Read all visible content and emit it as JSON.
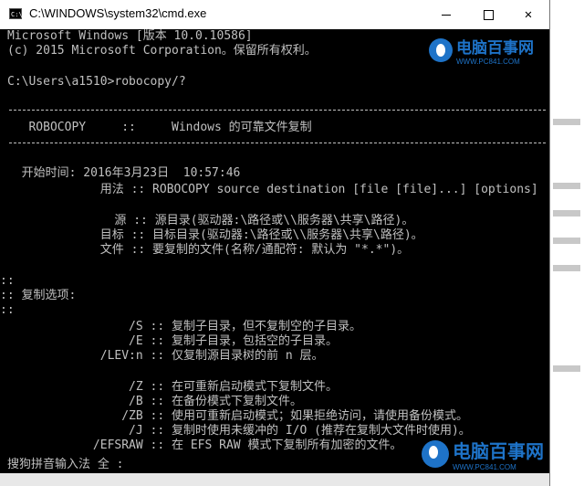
{
  "window": {
    "title": "C:\\WINDOWS\\system32\\cmd.exe",
    "icon_label": "C:\\",
    "close_glyph": "✕"
  },
  "console": {
    "lines": [
      "Microsoft Windows [版本 10.0.10586]",
      "(c) 2015 Microsoft Corporation。保留所有权利。",
      "C:\\Users\\a1510>robocopy/?",
      "   ROBOCOPY     ::     Windows 的可靠文件复制",
      "  开始时间: 2016年3月23日  10:57:46",
      "             用法 :: ROBOCOPY source destination [file [file]...] [options]",
      "               源 :: 源目录(驱动器:\\路径或\\\\服务器\\共享\\路径)。",
      "             目标 :: 目标目录(驱动器:\\路径或\\\\服务器\\共享\\路径)。",
      "             文件 :: 要复制的文件(名称/通配符: 默认为 \"*.*\")。",
      "::",
      ":: 复制选项:",
      "::",
      "                 /S :: 复制子目录，但不复制空的子目录。",
      "                 /E :: 复制子目录，包括空的子目录。",
      "             /LEV:n :: 仅复制源目录树的前 n 层。",
      "                 /Z :: 在可重新启动模式下复制文件。",
      "                 /B :: 在备份模式下复制文件。",
      "                /ZB :: 使用可重新启动模式；如果拒绝访问，请使用备份模式。",
      "                 /J :: 复制时使用未缓冲的 I/O (推荐在复制大文件时使用)。",
      "            /EFSRAW :: 在 EFS RAW 模式下复制所有加密的文件。"
    ],
    "ime_status": "搜狗拼音输入法 全 :"
  },
  "watermark": {
    "brand": "电脑百事网",
    "url": "WWW.PC841.COM"
  },
  "colors": {
    "console_bg": "#000000",
    "console_fg": "#c0c0c0",
    "watermark": "#1e73c8"
  }
}
